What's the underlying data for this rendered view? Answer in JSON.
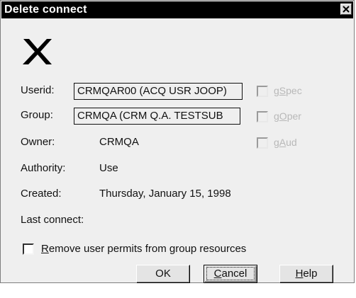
{
  "dialog": {
    "title": "Delete connect",
    "close_icon": "close-icon",
    "delete_icon": "x-mark-icon"
  },
  "fields": {
    "userid_label": "Userid:",
    "userid_value": "CRMQAR00 (ACQ USR JOOP)",
    "group_label": "Group:",
    "group_value": "CRMQA (CRM Q.A. TESTSUB",
    "owner_label": "Owner:",
    "owner_value": "CRMQA",
    "authority_label": "Authority:",
    "authority_value": "Use",
    "created_label": "Created:",
    "created_value": "Thursday, January 15, 1998",
    "last_connect_label": "Last connect:"
  },
  "options": {
    "gspec": {
      "prefix": "g",
      "accel": "S",
      "rest": "pec",
      "checked": false,
      "enabled": false
    },
    "goper": {
      "prefix": "g",
      "accel": "O",
      "rest": "per",
      "checked": false,
      "enabled": false
    },
    "gaud": {
      "prefix": "g",
      "accel": "A",
      "rest": "ud",
      "checked": false,
      "enabled": false
    },
    "remove_permits": {
      "accel": "R",
      "rest": "emove user permits from group resources",
      "checked": false
    }
  },
  "buttons": {
    "ok": "OK",
    "cancel_accel": "C",
    "cancel_rest": "ancel",
    "help_accel": "H",
    "help_rest": "elp"
  }
}
